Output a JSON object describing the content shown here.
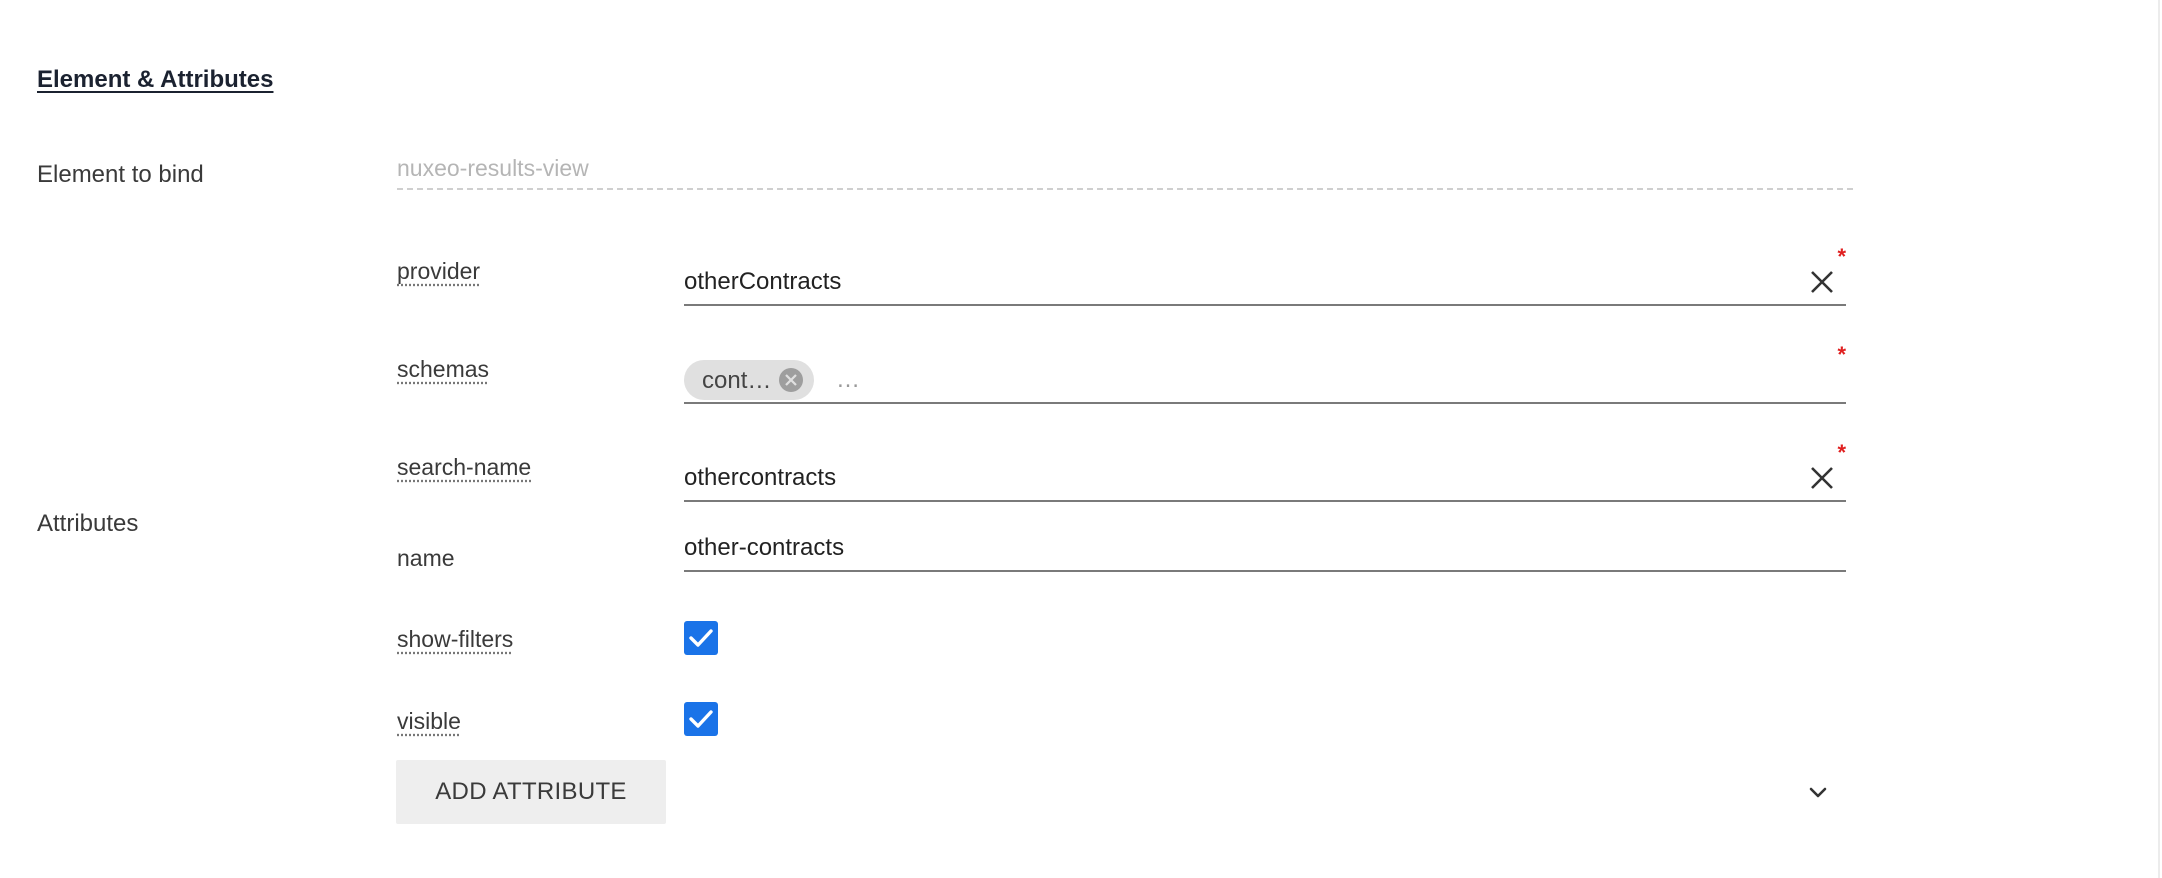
{
  "section": {
    "title": "Element & Attributes"
  },
  "element": {
    "label": "Element to bind",
    "placeholder": "nuxeo-results-view"
  },
  "attributes": {
    "label": "Attributes",
    "provider": {
      "name": "provider",
      "value": "otherContracts",
      "required": "*"
    },
    "schemas": {
      "name": "schemas",
      "chip": "cont…",
      "input_placeholder": "…",
      "required": "*"
    },
    "search_name": {
      "name": "search-name",
      "value": "othercontracts",
      "required": "*"
    },
    "name_attr": {
      "name": "name",
      "value": "other-contracts"
    },
    "show_filters": {
      "name": "show-filters",
      "checked": true
    },
    "visible": {
      "name": "visible",
      "checked": true
    }
  },
  "actions": {
    "add_attribute": "ADD ATTRIBUTE"
  },
  "colors": {
    "accent": "#1a73e8",
    "required": "#e02020",
    "chip": "#e0e0e0"
  },
  "icons": {
    "clear": "close-icon",
    "chip_remove": "remove-chip-icon",
    "check": "check-icon",
    "expand": "chevron-down-icon"
  }
}
